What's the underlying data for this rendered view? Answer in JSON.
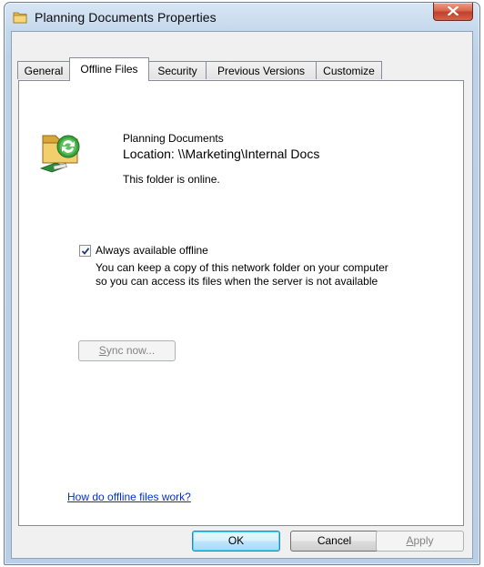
{
  "window": {
    "title": "Planning Documents Properties"
  },
  "tabs": [
    {
      "label": "General",
      "active": false
    },
    {
      "label": "Offline Files",
      "active": true
    },
    {
      "label": "Security",
      "active": false
    },
    {
      "label": "Previous Versions",
      "active": false
    },
    {
      "label": "Customize",
      "active": false
    }
  ],
  "offline": {
    "folder_name": "Planning Documents",
    "location": "Location: \\\\Marketing\\Internal Docs",
    "status": "This folder is online.",
    "checkbox_label": "Always available offline",
    "checkbox_checked": true,
    "description_line1": "You can keep a copy of this network folder on your computer",
    "description_line2": "so you can access its files when the server is not available",
    "sync_prefix": "S",
    "sync_rest": "ync now...",
    "help_link": "How do offline files work?"
  },
  "buttons": {
    "ok": "OK",
    "cancel": "Cancel",
    "apply_prefix": "A",
    "apply_rest": "pply"
  },
  "icons": {
    "title": "folder-icon",
    "close": "close-icon",
    "big": "offline-folder-sync-icon",
    "check": "checkmark-icon"
  },
  "colors": {
    "close_button": "#c2402a",
    "link": "#0033cc",
    "default_button_border": "#3c7fb1"
  }
}
